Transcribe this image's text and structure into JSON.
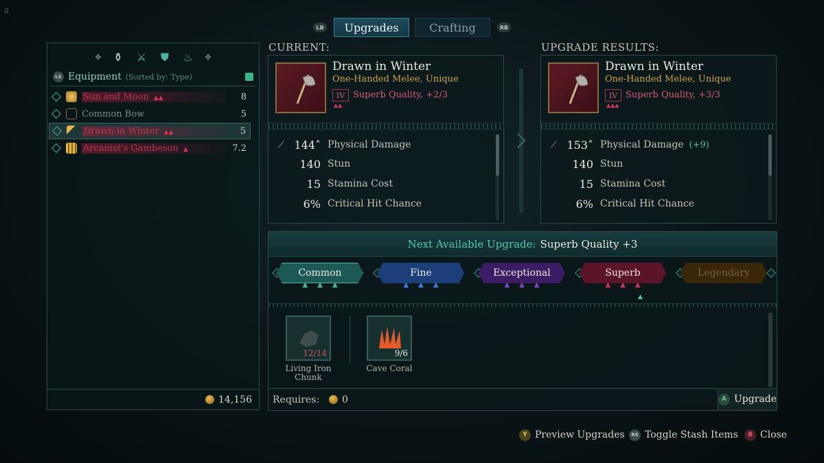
{
  "tabs": {
    "lb": "LB",
    "rb": "RB",
    "upgrades": "Upgrades",
    "crafting": "Crafting"
  },
  "equipment": {
    "ls": "LS",
    "title": "Equipment",
    "sort": "(Sorted by: Type)",
    "items": [
      {
        "name": "Sun and Moon",
        "stars": "▲▲",
        "value": "8"
      },
      {
        "name": "Common Bow",
        "stars": "",
        "value": "5"
      },
      {
        "name": "Drawn in Winter",
        "stars": "▲▲",
        "value": "5"
      },
      {
        "name": "Arcanist's Gambeson",
        "stars": "▲",
        "value": "7.2"
      }
    ],
    "gold": "14,156"
  },
  "current": {
    "label": "CURRENT:",
    "name": "Drawn in Winter",
    "type": "One-Handed Melee, Unique",
    "rank": "IV",
    "rank_stars": "▲▲",
    "quality": "Superb Quality, +2/3",
    "stats": [
      {
        "value": "144˄",
        "name": "Physical Damage",
        "bonus": ""
      },
      {
        "value": "140",
        "name": "Stun",
        "bonus": ""
      },
      {
        "value": "15",
        "name": "Stamina Cost",
        "bonus": ""
      },
      {
        "value": "6%",
        "name": "Critical Hit Chance",
        "bonus": ""
      }
    ]
  },
  "result": {
    "label": "UPGRADE RESULTS:",
    "name": "Drawn in Winter",
    "type": "One-Handed Melee, Unique",
    "rank": "IV",
    "rank_stars": "▲▲▲",
    "quality": "Superb Quality, +3/3",
    "stats": [
      {
        "value": "153˄",
        "name": "Physical Damage",
        "bonus": "(+9)"
      },
      {
        "value": "140",
        "name": "Stun",
        "bonus": ""
      },
      {
        "value": "15",
        "name": "Stamina Cost",
        "bonus": ""
      },
      {
        "value": "6%",
        "name": "Critical Hit Chance",
        "bonus": ""
      }
    ]
  },
  "upgrade": {
    "next_label": "Next Available Upgrade:",
    "next_value": "Superb Quality +3",
    "tiers": [
      {
        "name": "Common",
        "color": "#1d5a56",
        "border": "#4fb5a2",
        "pip": "#4fb5a2"
      },
      {
        "name": "Fine",
        "color": "#1c3f7a",
        "border": "#3b7de0",
        "pip": "#3b7de0"
      },
      {
        "name": "Exceptional",
        "color": "#3d1c66",
        "border": "#7b45c8",
        "pip": "#7b45c8"
      },
      {
        "name": "Superb",
        "color": "#5c1428",
        "border": "#d0365a",
        "pip": "#d0365a"
      },
      {
        "name": "Legendary",
        "color": "#3a2608",
        "border": "#b07a20",
        "pip": "#1a1410"
      }
    ],
    "materials": [
      {
        "name": "Living Iron Chunk",
        "count": "12/14",
        "insufficient": true
      },
      {
        "name": "Cave Coral",
        "count": "9/6",
        "insufficient": false
      }
    ],
    "requires_label": "Requires:",
    "requires_value": "0",
    "button_key": "A",
    "button_label": "Upgrade"
  },
  "hints": {
    "preview_key": "Y",
    "preview": "Preview Upgrades",
    "toggle_key": "RS",
    "toggle": "Toggle Stash Items",
    "close_key": "B",
    "close": "Close"
  }
}
